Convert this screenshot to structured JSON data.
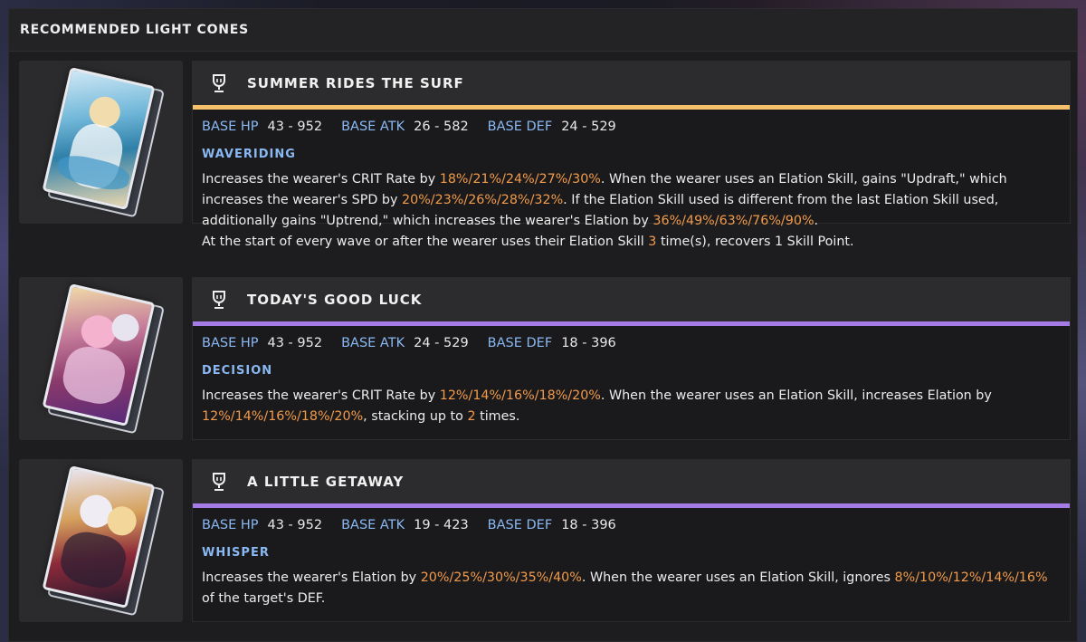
{
  "section_title": "RECOMMENDED LIGHT CONES",
  "colors": {
    "stat_label": "#8ab8f2",
    "highlight": "#f19a4a",
    "rarity_5": "#f5c26b",
    "rarity_4": "#a57ce6"
  },
  "cones": [
    {
      "name": "SUMMER RIDES THE SURF",
      "rarity_color": "#f5c26b",
      "icon": "trophy-icon",
      "stats": {
        "hp_label": "BASE HP",
        "hp": "43 - 952",
        "atk_label": "BASE ATK",
        "atk": "26 - 582",
        "def_label": "BASE DEF",
        "def": "24 - 529"
      },
      "skill": "WAVERIDING",
      "desc": [
        {
          "t": "Increases the wearer's CRIT Rate by "
        },
        {
          "t": "18%/21%/24%/27%/30%",
          "hl": true
        },
        {
          "t": ". When the wearer uses an Elation Skill, gains \"Updraft,\" which increases the wearer's SPD by "
        },
        {
          "t": "20%/23%/26%/28%/32%",
          "hl": true
        },
        {
          "t": ". If the Elation Skill used is different from the last Elation Skill used, additionally gains \"Uptrend,\" which increases the wearer's Elation by "
        },
        {
          "t": "36%/49%/63%/76%/90%",
          "hl": true
        },
        {
          "t": ".",
          "br": true
        },
        {
          "t": "At the start of every wave or after the wearer uses their Elation Skill "
        },
        {
          "t": "3",
          "hl": true
        },
        {
          "t": " time(s), recovers 1 Skill Point."
        }
      ]
    },
    {
      "name": "TODAY'S GOOD LUCK",
      "rarity_color": "#a57ce6",
      "icon": "trophy-icon",
      "stats": {
        "hp_label": "BASE HP",
        "hp": "43 - 952",
        "atk_label": "BASE ATK",
        "atk": "24 - 529",
        "def_label": "BASE DEF",
        "def": "18 - 396"
      },
      "skill": "DECISION",
      "desc": [
        {
          "t": "Increases the wearer's CRIT Rate by "
        },
        {
          "t": "12%/14%/16%/18%/20%",
          "hl": true
        },
        {
          "t": ". When the wearer uses an Elation Skill, increases Elation by "
        },
        {
          "t": "12%/14%/16%/18%/20%",
          "hl": true
        },
        {
          "t": ", stacking up to "
        },
        {
          "t": "2",
          "hl": true
        },
        {
          "t": " times."
        }
      ]
    },
    {
      "name": "A LITTLE GETAWAY",
      "rarity_color": "#a57ce6",
      "icon": "trophy-icon",
      "stats": {
        "hp_label": "BASE HP",
        "hp": "43 - 952",
        "atk_label": "BASE ATK",
        "atk": "19 - 423",
        "def_label": "BASE DEF",
        "def": "18 - 396"
      },
      "skill": "WHISPER",
      "desc": [
        {
          "t": "Increases the wearer's Elation by "
        },
        {
          "t": "20%/25%/30%/35%/40%",
          "hl": true
        },
        {
          "t": ". When the wearer uses an Elation Skill, ignores "
        },
        {
          "t": "8%/10%/12%/14%/16%",
          "hl": true
        },
        {
          "t": " of the target's DEF."
        }
      ]
    }
  ]
}
